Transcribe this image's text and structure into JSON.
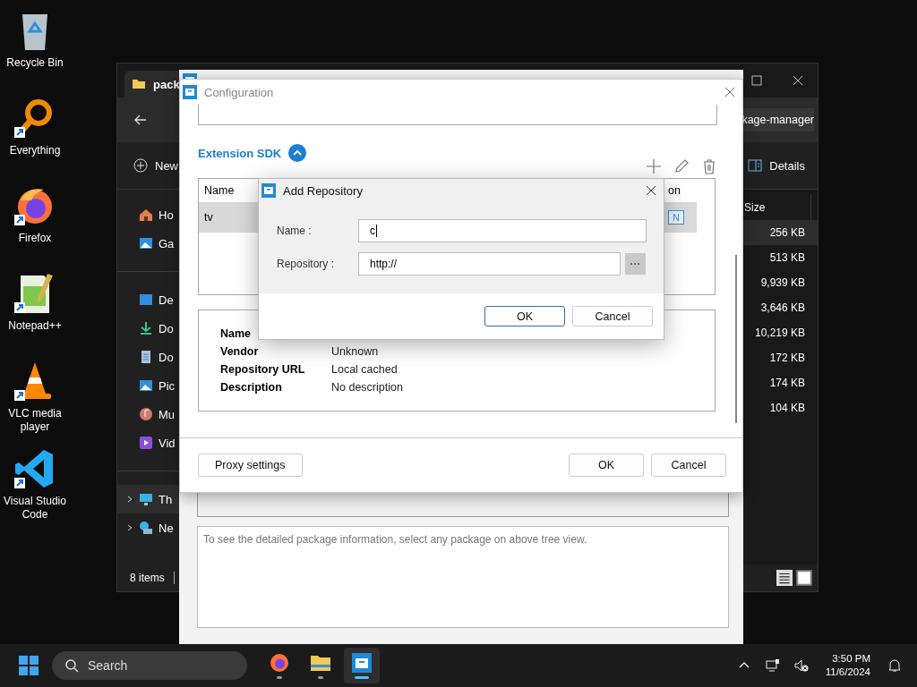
{
  "desktop_icons": [
    {
      "label": "Recycle Bin",
      "kind": "recycle",
      "shortcut": false
    },
    {
      "label": "Everything",
      "kind": "search",
      "shortcut": true
    },
    {
      "label": "Firefox",
      "kind": "firefox",
      "shortcut": true
    },
    {
      "label": "Notepad++",
      "kind": "notepad",
      "shortcut": true
    },
    {
      "label": "VLC media player",
      "kind": "cone",
      "shortcut": true
    },
    {
      "label": "Visual Studio Code",
      "kind": "code",
      "shortcut": true
    }
  ],
  "explorer": {
    "tab_title": "pack",
    "address": "kage-manager",
    "new_label": "New",
    "view_label": "Details",
    "nav_groups": [
      [
        {
          "label": "Ho",
          "kind": "home",
          "selected": false,
          "expandable": false
        },
        {
          "label": "Ga",
          "kind": "gallery",
          "selected": false,
          "expandable": false
        }
      ],
      [
        {
          "label": "De",
          "kind": "desktop",
          "selected": false,
          "expandable": false
        },
        {
          "label": "Do",
          "kind": "download",
          "selected": false,
          "expandable": false
        },
        {
          "label": "Do",
          "kind": "document",
          "selected": false,
          "expandable": false
        },
        {
          "label": "Pic",
          "kind": "gallery",
          "selected": false,
          "expandable": false
        },
        {
          "label": "Mu",
          "kind": "music",
          "selected": false,
          "expandable": false
        },
        {
          "label": "Vid",
          "kind": "video",
          "selected": false,
          "expandable": false
        }
      ],
      [
        {
          "label": "Th",
          "kind": "pc",
          "selected": true,
          "expandable": true
        },
        {
          "label": "Ne",
          "kind": "network",
          "selected": false,
          "expandable": true
        }
      ]
    ],
    "size_header": "Size",
    "sizes": [
      {
        "text": "256 KB",
        "selected": true
      },
      {
        "text": "513 KB",
        "selected": false
      },
      {
        "text": "9,939 KB",
        "selected": false
      },
      {
        "text": "3,646 KB",
        "selected": false
      },
      {
        "text": "10,219 KB",
        "selected": false
      },
      {
        "text": "172 KB",
        "selected": false
      },
      {
        "text": "174 KB",
        "selected": false
      },
      {
        "text": "104 KB",
        "selected": false
      }
    ],
    "status": "8 items"
  },
  "package_manager": {
    "info_text": "To see the detailed package information, select any package on above tree view."
  },
  "configuration": {
    "title": "Configuration",
    "section": "Extension SDK",
    "expanded": true,
    "table": {
      "columns": [
        "Name",
        "on"
      ],
      "rows": [
        {
          "cells": [
            "tv",
            "N"
          ],
          "selected": true
        }
      ]
    },
    "details": [
      {
        "label": "Name"
      },
      {
        "label": "Vendor",
        "value": "Unknown"
      },
      {
        "label": "Repository URL",
        "value": "Local cached"
      },
      {
        "label": "Description",
        "value": "No description"
      }
    ],
    "left_button": "Proxy settings",
    "buttons": [
      "OK",
      "Cancel"
    ]
  },
  "add_repository": {
    "title": "Add Repository",
    "fields": [
      {
        "label": "Name :",
        "value": "c"
      },
      {
        "label": "Repository :",
        "value": "http://",
        "browse": "···"
      }
    ],
    "buttons": [
      {
        "label": "OK",
        "default": true
      },
      {
        "label": "Cancel",
        "default": false
      }
    ]
  },
  "taskbar": {
    "search_placeholder": "Search",
    "apps": [
      {
        "kind": "firefox",
        "selected": false
      },
      {
        "kind": "folder",
        "selected": false
      },
      {
        "kind": "package",
        "selected": true
      }
    ],
    "time": "3:50 PM",
    "date": "11/6/2024"
  }
}
